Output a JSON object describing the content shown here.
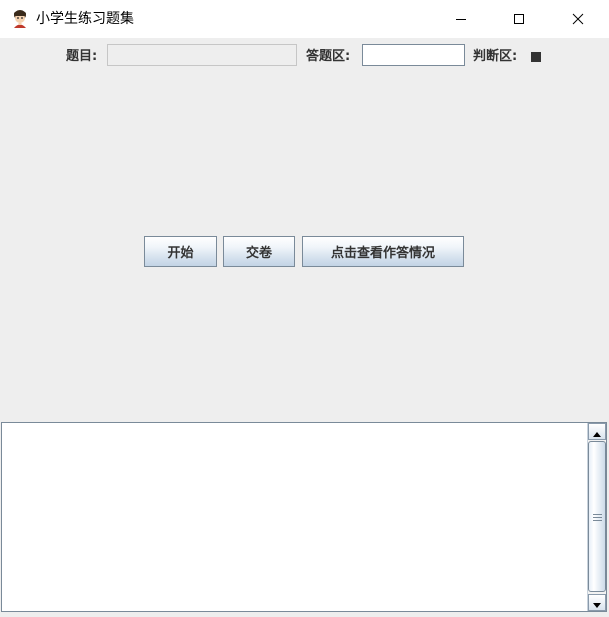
{
  "window": {
    "title": "小学生练习题集",
    "icon": "student-avatar-icon",
    "controls": [
      "minimize-icon",
      "maximize-icon",
      "close-icon"
    ]
  },
  "form": {
    "question_label": "题目:",
    "question_value": "",
    "answer_label": "答题区:",
    "answer_value": "",
    "answer_placeholder": "",
    "judge_label": "判断区:",
    "judge_indicator_color": "#333333"
  },
  "buttons": {
    "start": "开始",
    "submit": "交卷",
    "view_results": "点击查看作答情况"
  },
  "results": {
    "text": ""
  },
  "colors": {
    "background": "#eeeeee",
    "titlebar": "#ffffff",
    "button_border": "#7a8a99",
    "label_text": "#333333"
  }
}
